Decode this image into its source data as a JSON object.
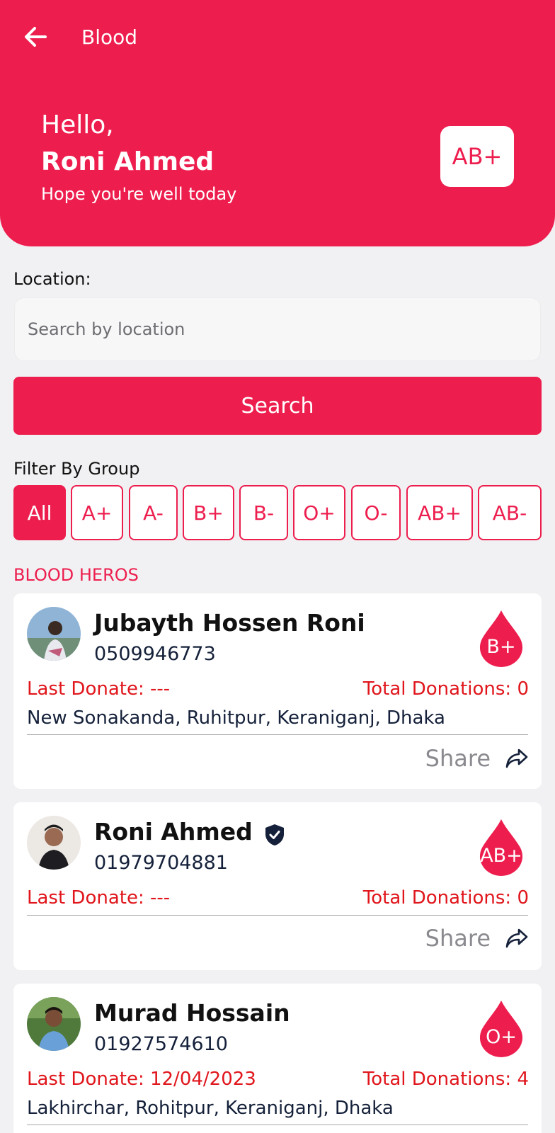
{
  "header": {
    "title": "Blood",
    "greeting": "Hello,",
    "user_name": "Roni Ahmed",
    "subtitle": "Hope you're well today",
    "user_group": "AB+"
  },
  "search": {
    "label": "Location:",
    "placeholder": "Search by location",
    "value": "",
    "button_label": "Search"
  },
  "filter": {
    "label": "Filter By Group",
    "selected": "All",
    "groups": [
      "All",
      "A+",
      "A-",
      "B+",
      "B-",
      "O+",
      "O-",
      "AB+",
      "AB-"
    ]
  },
  "section_title": "BLOOD HEROS",
  "share_label": "Share",
  "donors": [
    {
      "name": "Jubayth Hossen Roni",
      "phone": "0509946773",
      "group": "B+",
      "last_donate": "Last Donate: ---",
      "total_donations": "Total Donations: 0",
      "address": "New Sonakanda, Ruhitpur, Keraniganj, Dhaka",
      "verified": false
    },
    {
      "name": "Roni Ahmed",
      "phone": "01979704881",
      "group": "AB+",
      "last_donate": "Last Donate: ---",
      "total_donations": "Total Donations: 0",
      "address": "",
      "verified": true
    },
    {
      "name": "Murad Hossain",
      "phone": "01927574610",
      "group": "O+",
      "last_donate": "Last Donate: 12/04/2023",
      "total_donations": "Total Donations: 4",
      "address": "Lakhirchar, Rohitpur, Keraniganj, Dhaka",
      "verified": false
    }
  ],
  "icons": {
    "back": "arrow-left-icon",
    "share": "share-arrow-icon",
    "verified": "verified-shield-icon",
    "blood_drop": "blood-drop-icon"
  },
  "colors": {
    "primary": "#ed1e4e",
    "background": "#f1f1f3",
    "danger_text": "#e0161c",
    "dark_text": "#15213a"
  }
}
